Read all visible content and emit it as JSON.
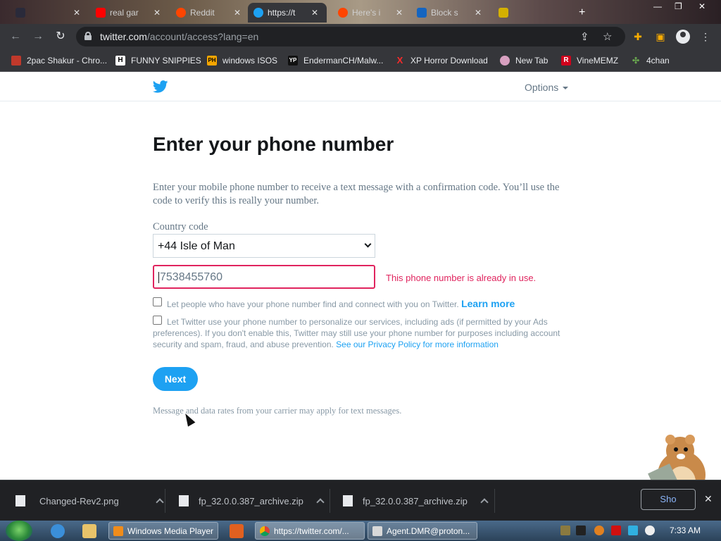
{
  "browser": {
    "tabs": [
      {
        "label": "",
        "active": false
      },
      {
        "label": "real gar",
        "active": false
      },
      {
        "label": "Reddit",
        "active": false
      },
      {
        "label": "https://t",
        "active": true
      },
      {
        "label": "Here's i",
        "active": false
      },
      {
        "label": "Block s",
        "active": false
      },
      {
        "label": "",
        "active": false
      }
    ],
    "url_host": "twitter.com",
    "url_path": "/account/access?lang=en",
    "bookmarks": [
      {
        "label": "2pac Shakur - Chro...",
        "icon_text": ""
      },
      {
        "label": "FUNNY SNIPPIES",
        "icon_text": "H"
      },
      {
        "label": "windows ISOS",
        "icon_text": "PH"
      },
      {
        "label": "EndermanCH/Malw...",
        "icon_text": "YP"
      },
      {
        "label": "XP Horror Download",
        "icon_text": "X"
      },
      {
        "label": "New Tab",
        "icon_text": ""
      },
      {
        "label": "VineMEMZ",
        "icon_text": "R"
      },
      {
        "label": "4chan",
        "icon_text": ""
      }
    ]
  },
  "page": {
    "options_label": "Options",
    "heading": "Enter your phone number",
    "description": "Enter your mobile phone number to receive a text message with a confirmation code. You’ll use the code to verify this is really your number.",
    "country_label": "Country code",
    "country_value": "+44 Isle of Man",
    "phone_value": "7538455760",
    "error_text": "This phone number is already in use.",
    "checkbox1_text": "Let people who have your phone number find and connect with you on Twitter.",
    "checkbox1_link": "Learn more",
    "checkbox2_text": "Let Twitter use your phone number to personalize our services, including ads (if permitted by your Ads preferences). If you don't enable this, Twitter may still use your phone number for purposes including account security and spam, fraud, and abuse prevention.",
    "checkbox2_link": "See our Privacy Policy for more information",
    "next_label": "Next",
    "footnote": "Message and data rates from your carrier may apply for text messages."
  },
  "downloads": {
    "items": [
      {
        "name": "Changed-Rev2.png"
      },
      {
        "name": "fp_32.0.0.387_archive.zip"
      },
      {
        "name": "fp_32.0.0.387_archive.zip"
      }
    ],
    "show_all_label": "Sho"
  },
  "taskbar": {
    "tasks": [
      {
        "label": "Windows Media Player"
      },
      {
        "label": "https://twitter.com/..."
      },
      {
        "label": "Agent.DMR@proton..."
      }
    ],
    "clock": "7:33 AM"
  },
  "colors": {
    "twitter_blue": "#1da1f2",
    "error_red": "#e0245e",
    "chrome_dark": "#35363a"
  }
}
